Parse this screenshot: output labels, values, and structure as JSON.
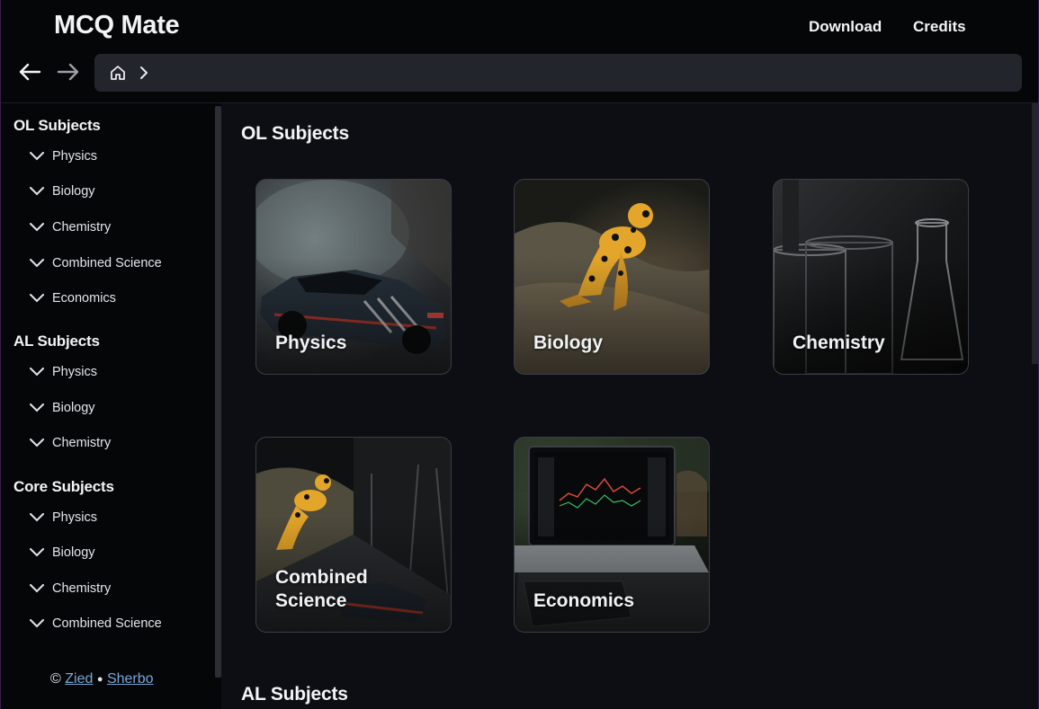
{
  "app": {
    "title": "MCQ Mate"
  },
  "header": {
    "links": [
      "Download",
      "Credits"
    ]
  },
  "sidebar": {
    "groups": [
      {
        "title": "OL Subjects",
        "items": [
          "Physics",
          "Biology",
          "Chemistry",
          "Combined Science",
          "Economics"
        ]
      },
      {
        "title": "AL Subjects",
        "items": [
          "Physics",
          "Biology",
          "Chemistry"
        ]
      },
      {
        "title": "Core Subjects",
        "items": [
          "Physics",
          "Biology",
          "Chemistry",
          "Combined Science"
        ]
      }
    ],
    "footer": {
      "copyright": "©",
      "author1": "Zied",
      "separator": "●",
      "author2": "Sherbo"
    }
  },
  "main": {
    "sections": [
      {
        "title": "OL Subjects",
        "cards": [
          "Physics",
          "Biology",
          "Chemistry",
          "Combined Science",
          "Economics"
        ]
      },
      {
        "title": "AL Subjects",
        "cards": []
      }
    ]
  },
  "icons": {
    "back": "arrow-left-icon",
    "forward": "arrow-right-icon",
    "home": "home-icon",
    "chevron": "chevron-right-icon",
    "expand": "chevron-down-icon"
  },
  "colors": {
    "background": "#050608",
    "panel": "#0c0e13",
    "addressbar": "#22252c",
    "link": "#7aa7d6",
    "frog": "#e3a52a"
  }
}
